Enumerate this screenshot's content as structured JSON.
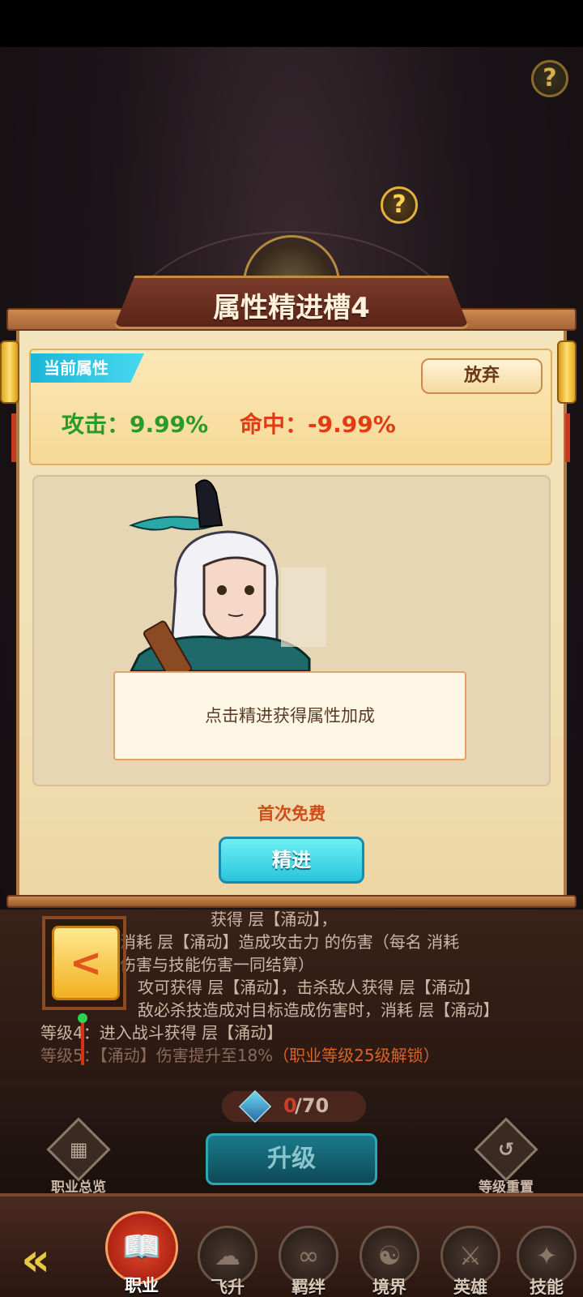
{
  "dialog": {
    "title": "属性精进槽4",
    "current_tag": "当前属性",
    "abandon_label": "放弃",
    "attack_stat": "攻击：9.99%",
    "hit_stat": "命中：-9.99%",
    "hint": "点击精进获得属性加成",
    "first_free": "首次免费",
    "refine_label": "精进"
  },
  "skill_text": {
    "line1": "获得 层【涌动】，",
    "line2": "消耗 层【涌动】造成攻击力 的伤害（每名 消耗",
    "line3": "伤害与技能伤害一同结算）",
    "line4": "攻可获得 层【涌动】，击杀敌人获得 层【涌动】",
    "line5": "敌必杀技造成对目标造成伤害时，消耗 层【涌动】",
    "line6": "等级4：进入战斗获得 层【涌动】",
    "line7a": "等级5：【涌动】伤害提升至18%",
    "line7b": "（职业等级25级解锁）"
  },
  "currency": {
    "have": "0",
    "total": "/70"
  },
  "controls": {
    "overview_label": "职业总览",
    "upgrade_label": "升级",
    "reset_label": "等级重置"
  },
  "nav": [
    {
      "label": "职业",
      "icon": "book-icon",
      "glyph": "📖"
    },
    {
      "label": "飞升",
      "icon": "cloud-icon",
      "glyph": "☁"
    },
    {
      "label": "羁绊",
      "icon": "knot-icon",
      "glyph": "∞"
    },
    {
      "label": "境界",
      "icon": "realm-icon",
      "glyph": "☯"
    },
    {
      "label": "英雄",
      "icon": "helmet-icon",
      "glyph": "⚔"
    },
    {
      "label": "技能",
      "icon": "skill-icon",
      "glyph": "✦"
    }
  ],
  "help_glyph": "?",
  "back_glyph": "<"
}
